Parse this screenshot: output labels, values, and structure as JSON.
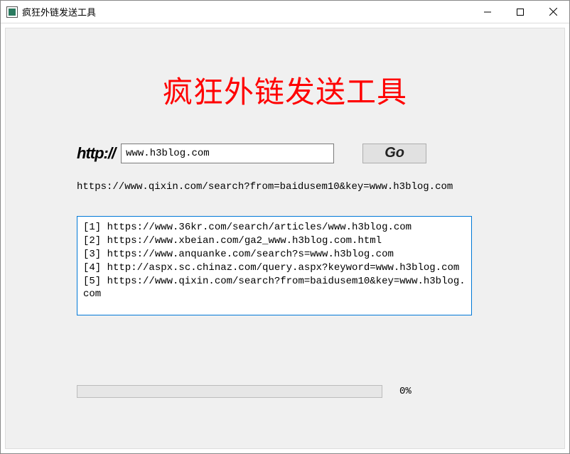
{
  "window": {
    "title": "疯狂外链发送工具"
  },
  "heading": "疯狂外链发送工具",
  "input": {
    "protocol_label": "http://",
    "url_value": "www.h3blog.com",
    "go_label": "Go"
  },
  "status_line": "https://www.qixin.com/search?from=baidusem10&key=www.h3blog.com",
  "log_entries": [
    "[1] https://www.36kr.com/search/articles/www.h3blog.com",
    "[2] https://www.xbeian.com/ga2_www.h3blog.com.html",
    "[3] https://www.anquanke.com/search?s=www.h3blog.com",
    "[4] http://aspx.sc.chinaz.com/query.aspx?keyword=www.h3blog.com",
    "[5] https://www.qixin.com/search?from=baidusem10&key=www.h3blog.com"
  ],
  "progress": {
    "percent_label": "0%",
    "percent_value": 0
  }
}
